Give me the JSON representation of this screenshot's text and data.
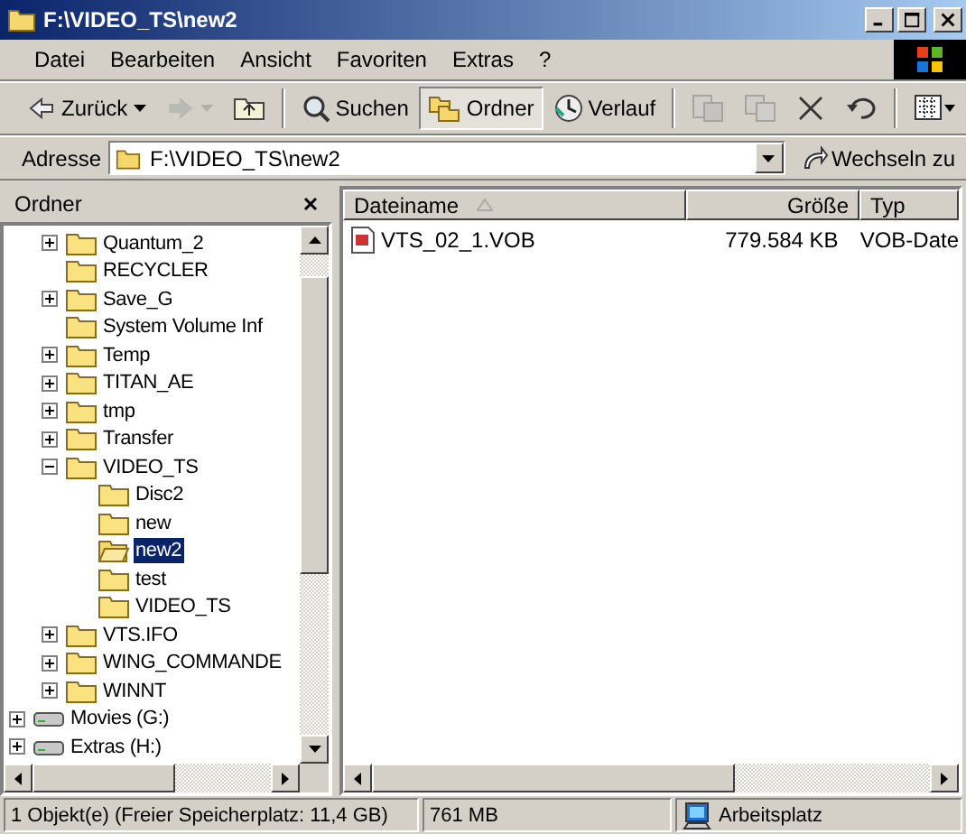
{
  "window": {
    "title": "F:\\VIDEO_TS\\new2"
  },
  "menu": [
    "Datei",
    "Bearbeiten",
    "Ansicht",
    "Favoriten",
    "Extras",
    "?"
  ],
  "toolbar": [
    {
      "kind": "back",
      "label": "Zurück",
      "disabled": false,
      "selected": false
    },
    {
      "kind": "forward",
      "disabled": true,
      "selected": false
    },
    {
      "kind": "up",
      "disabled": false,
      "selected": false
    },
    {
      "kind": "search",
      "label": "Suchen",
      "disabled": false,
      "selected": false
    },
    {
      "kind": "folders",
      "label": "Ordner",
      "disabled": false,
      "selected": true
    },
    {
      "kind": "history",
      "label": "Verlauf",
      "disabled": false,
      "selected": false
    },
    {
      "kind": "move",
      "disabled": true,
      "selected": false
    },
    {
      "kind": "copy",
      "disabled": true,
      "selected": false
    },
    {
      "kind": "delete",
      "disabled": false,
      "selected": false
    },
    {
      "kind": "undo",
      "disabled": false,
      "selected": false
    },
    {
      "kind": "views",
      "disabled": false,
      "selected": false
    }
  ],
  "address": {
    "label": "Adresse",
    "value": "F:\\VIDEO_TS\\new2",
    "go": "Wechseln zu"
  },
  "tree": {
    "title": "Ordner",
    "items": [
      {
        "kind": "hidden",
        "children": [
          {
            "label": "Quantum_2",
            "kind": "folder",
            "expanded": false,
            "selected": false
          },
          {
            "label": "RECYCLER",
            "kind": "folder",
            "selected": false
          },
          {
            "label": "Save_G",
            "kind": "folder",
            "expanded": false,
            "selected": false
          },
          {
            "label": "System Volume Inf",
            "kind": "folder",
            "selected": false
          },
          {
            "label": "Temp",
            "kind": "folder",
            "expanded": false,
            "selected": false
          },
          {
            "label": "TITAN_AE",
            "kind": "folder",
            "expanded": false,
            "selected": false
          },
          {
            "label": "tmp",
            "kind": "folder",
            "expanded": false,
            "selected": false
          },
          {
            "label": "Transfer",
            "kind": "folder",
            "expanded": false,
            "selected": false
          },
          {
            "label": "VIDEO_TS",
            "kind": "folder",
            "expanded": true,
            "selected": false,
            "children": [
              {
                "label": "Disc2",
                "kind": "folder",
                "selected": false
              },
              {
                "label": "new",
                "kind": "folder",
                "selected": false
              },
              {
                "label": "new2",
                "kind": "folder",
                "selected": true
              },
              {
                "label": "test",
                "kind": "folder",
                "selected": false
              },
              {
                "label": "VIDEO_TS",
                "kind": "folder",
                "selected": false
              }
            ]
          },
          {
            "label": "VTS.IFO",
            "kind": "folder",
            "expanded": false,
            "selected": false
          },
          {
            "label": "WING_COMMANDE",
            "kind": "folder",
            "expanded": false,
            "selected": false
          },
          {
            "label": "WINNT",
            "kind": "folder",
            "expanded": false,
            "selected": false
          }
        ]
      },
      {
        "label": "Movies (G:)",
        "kind": "drive",
        "expanded": false,
        "selected": false
      },
      {
        "label": "Extras (H:)",
        "kind": "drive",
        "expanded": false,
        "selected": false
      }
    ]
  },
  "files": {
    "columns": [
      {
        "label": "Dateiname",
        "sorted": true
      },
      {
        "label": "Größe",
        "sorted": false
      },
      {
        "label": "Typ",
        "sorted": false
      }
    ],
    "rows": [
      {
        "name": "VTS_02_1.VOB",
        "size": "779.584 KB",
        "type": "VOB-Date",
        "selected": false
      }
    ]
  },
  "status_bar": {
    "objects": "1 Objekt(e) (Freier Speicherplatz: 11,4 GB)",
    "size": "761 MB",
    "zone": "Arbeitsplatz"
  }
}
